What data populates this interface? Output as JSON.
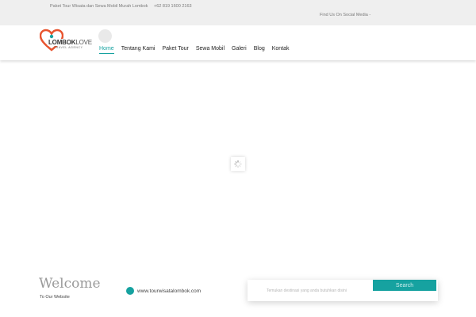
{
  "topbar": {
    "tagline": "Paket Tour Wisata dan Sewa Mobil Murah Lombok",
    "phone": "+62 819 1600 2163",
    "social": "Find Us On Social Media -"
  },
  "logo": {
    "brand_bold": "LOMBOK",
    "brand_light": "LOVE",
    "subtitle": "TRAVEL AGENCY"
  },
  "nav": {
    "items": [
      {
        "label": "Home",
        "active": true
      },
      {
        "label": "Tentang Kami"
      },
      {
        "label": "Paket Tour"
      },
      {
        "label": "Sewa Mobil"
      },
      {
        "label": "Galeri"
      },
      {
        "label": "Blog"
      },
      {
        "label": "Kontak"
      }
    ]
  },
  "hero": {
    "welcome": "Welcome",
    "to_our_website": "To Our Website",
    "website": "www.tourwisatalombok.com"
  },
  "search": {
    "placeholder": "Temukan destinasi yang anda butuhkan disini",
    "button_label": "Search"
  },
  "colors": {
    "accent": "#16a2a0",
    "topbar_bg": "#efefef"
  }
}
